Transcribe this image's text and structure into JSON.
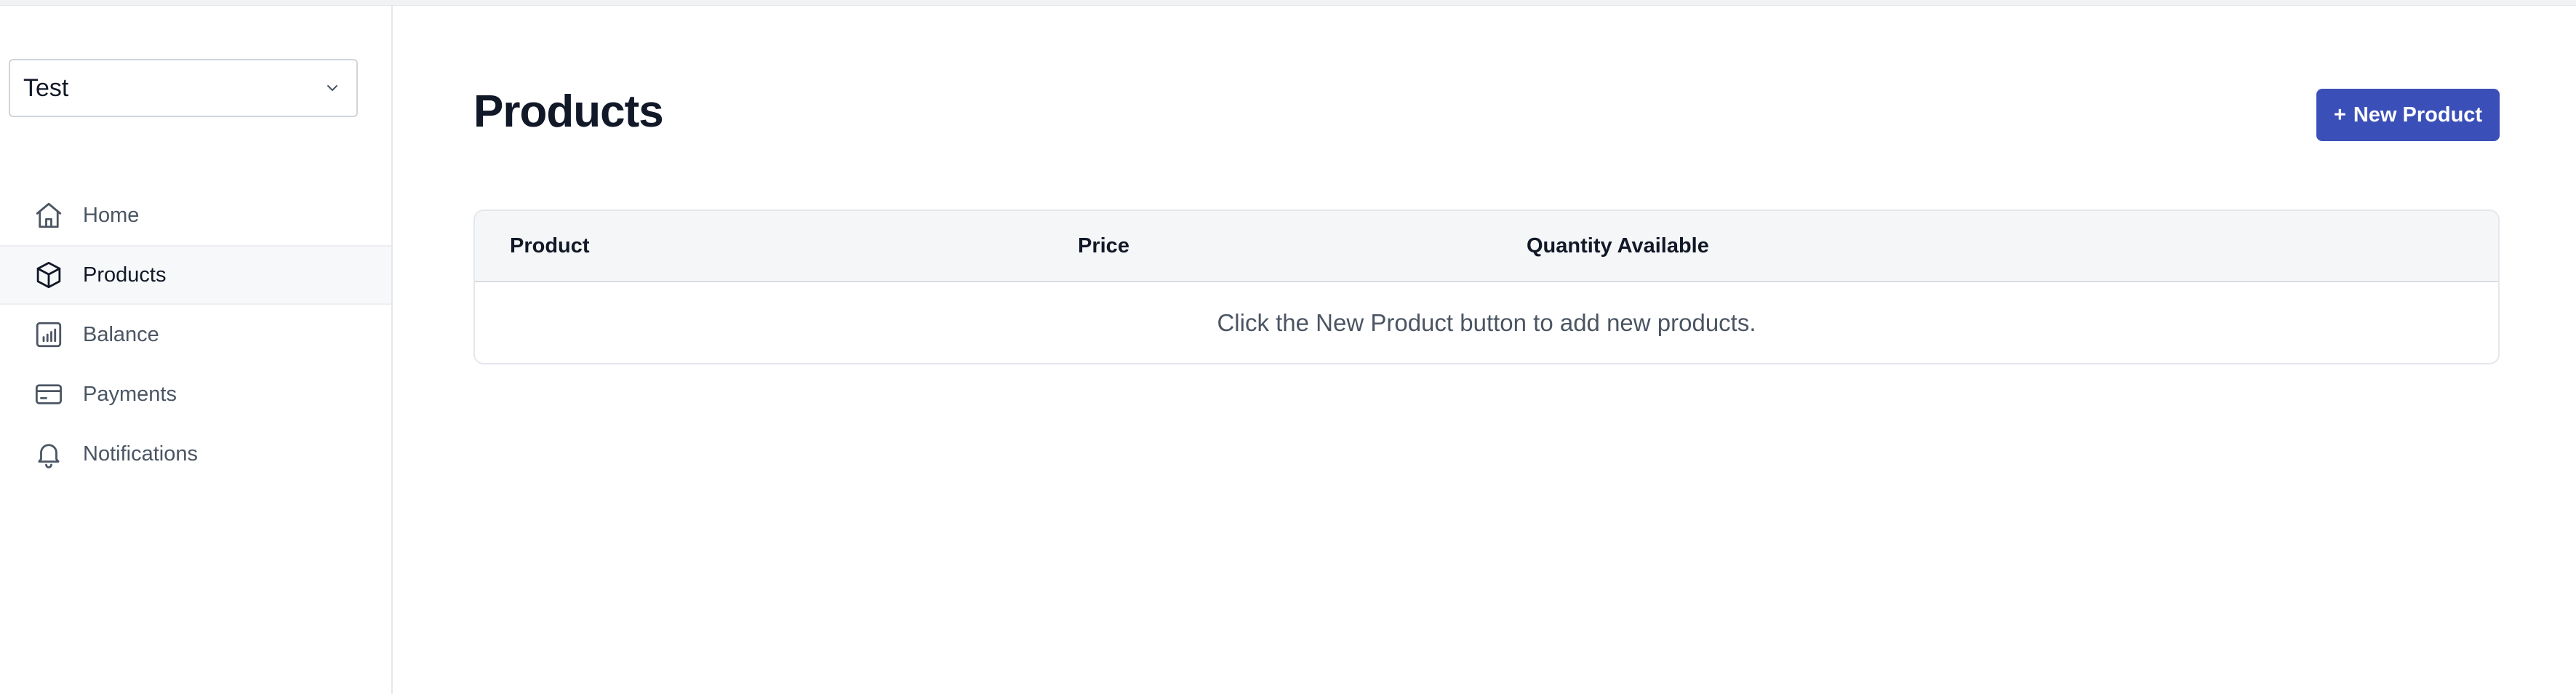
{
  "sidebar": {
    "store_select": {
      "value": "Test",
      "icon": "chevron-down-icon"
    },
    "items": [
      {
        "label": "Home",
        "icon": "home-icon",
        "active": false
      },
      {
        "label": "Products",
        "icon": "box-icon",
        "active": true
      },
      {
        "label": "Balance",
        "icon": "bar-chart-icon",
        "active": false
      },
      {
        "label": "Payments",
        "icon": "credit-card-icon",
        "active": false
      },
      {
        "label": "Notifications",
        "icon": "bell-icon",
        "active": false
      }
    ]
  },
  "main": {
    "title": "Products",
    "new_button": {
      "plus": "+",
      "label": "New Product"
    },
    "table": {
      "columns": [
        "Product",
        "Price",
        "Quantity Available"
      ],
      "empty_message": "Click the New Product button to add new products."
    }
  },
  "colors": {
    "accent": "#3b4fb8",
    "sidebar_active_bg": "#f7f8f9",
    "table_header_bg": "#f5f6f8",
    "border": "#e5e7eb"
  }
}
